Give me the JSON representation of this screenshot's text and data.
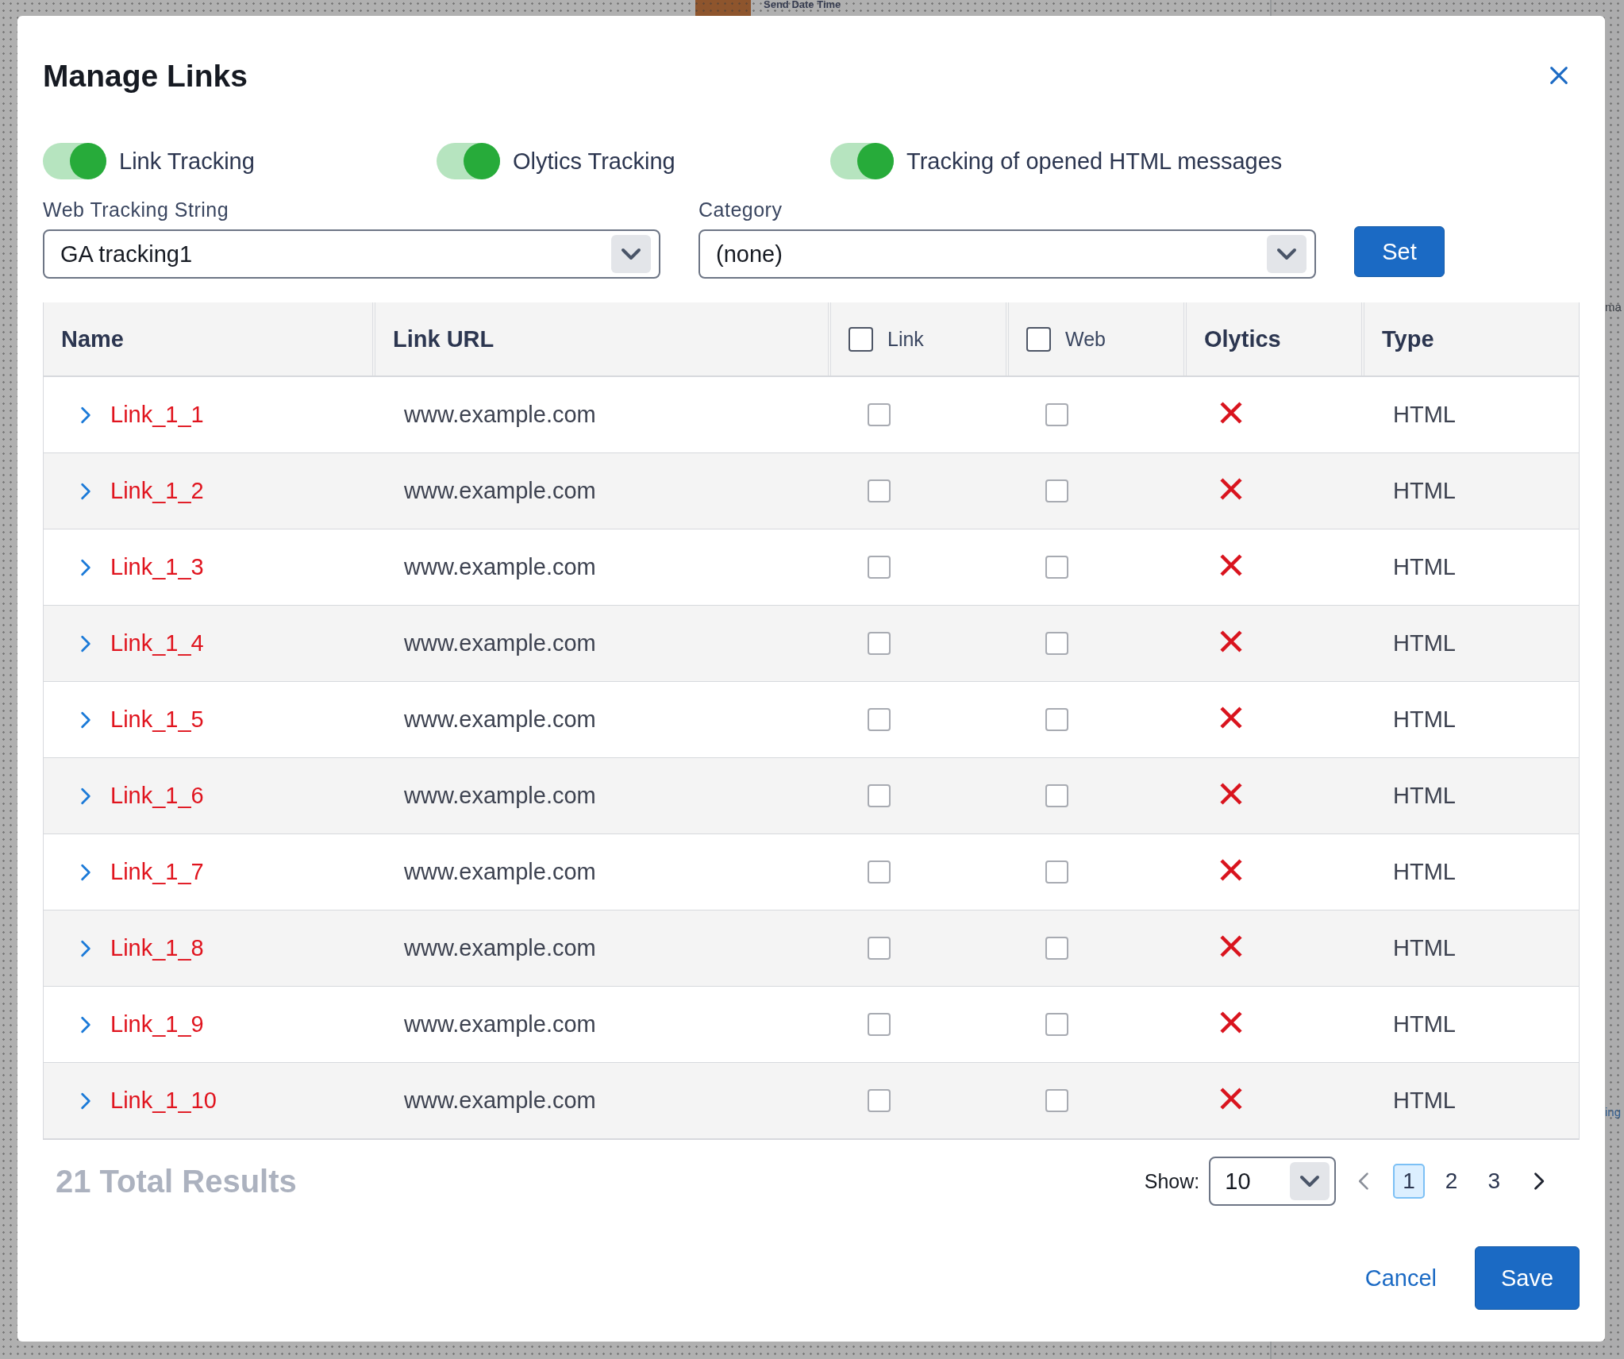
{
  "background": {
    "send_date_label": "Send Date Time",
    "side_fragments": [
      "ma",
      "ing"
    ]
  },
  "dialog": {
    "title": "Manage Links",
    "toggles": [
      {
        "label": "Link Tracking",
        "on": true
      },
      {
        "label": "Olytics Tracking",
        "on": true
      },
      {
        "label": "Tracking of opened HTML messages",
        "on": true
      }
    ],
    "web_tracking": {
      "label": "Web Tracking String",
      "value": "GA tracking1"
    },
    "category": {
      "label": "Category",
      "value": "(none)"
    },
    "set_button": "Set",
    "table": {
      "columns": [
        {
          "label": "Name",
          "kind": "text"
        },
        {
          "label": "Link URL",
          "kind": "text"
        },
        {
          "label": "Link",
          "kind": "checkbox",
          "checked": false
        },
        {
          "label": "Web",
          "kind": "checkbox",
          "checked": false
        },
        {
          "label": "Olytics",
          "kind": "text"
        },
        {
          "label": "Type",
          "kind": "text"
        }
      ],
      "rows": [
        {
          "name": "Link_1_1",
          "url": "www.example.com",
          "expanded": false,
          "link": false,
          "web": false,
          "olytics": false,
          "type": "HTML"
        },
        {
          "name": "Link_1_2",
          "url": "www.example.com",
          "expanded": false,
          "link": false,
          "web": false,
          "olytics": false,
          "type": "HTML"
        },
        {
          "name": "Link_1_3",
          "url": "www.example.com",
          "expanded": false,
          "link": false,
          "web": false,
          "olytics": false,
          "type": "HTML"
        },
        {
          "name": "Link_1_4",
          "url": "www.example.com",
          "expanded": false,
          "link": false,
          "web": false,
          "olytics": false,
          "type": "HTML"
        },
        {
          "name": "Link_1_5",
          "url": "www.example.com",
          "expanded": false,
          "link": false,
          "web": false,
          "olytics": false,
          "type": "HTML"
        },
        {
          "name": "Link_1_6",
          "url": "www.example.com",
          "expanded": false,
          "link": false,
          "web": false,
          "olytics": false,
          "type": "HTML"
        },
        {
          "name": "Link_1_7",
          "url": "www.example.com",
          "expanded": false,
          "link": false,
          "web": false,
          "olytics": false,
          "type": "HTML"
        },
        {
          "name": "Link_1_8",
          "url": "www.example.com",
          "expanded": false,
          "link": false,
          "web": false,
          "olytics": false,
          "type": "HTML"
        },
        {
          "name": "Link_1_9",
          "url": "www.example.com",
          "expanded": false,
          "link": false,
          "web": false,
          "olytics": false,
          "type": "HTML"
        },
        {
          "name": "Link_1_10",
          "url": "www.example.com",
          "expanded": false,
          "link": false,
          "web": false,
          "olytics": false,
          "type": "HTML"
        }
      ]
    },
    "total_results": "21 Total Results",
    "show": {
      "label": "Show:",
      "value": "10"
    },
    "pages": [
      {
        "label": "1",
        "selected": true
      },
      {
        "label": "2",
        "selected": false
      },
      {
        "label": "3",
        "selected": false
      }
    ],
    "buttons": [
      {
        "label": "Cancel",
        "kind": "link"
      },
      {
        "label": "Save",
        "kind": "primary"
      }
    ]
  }
}
